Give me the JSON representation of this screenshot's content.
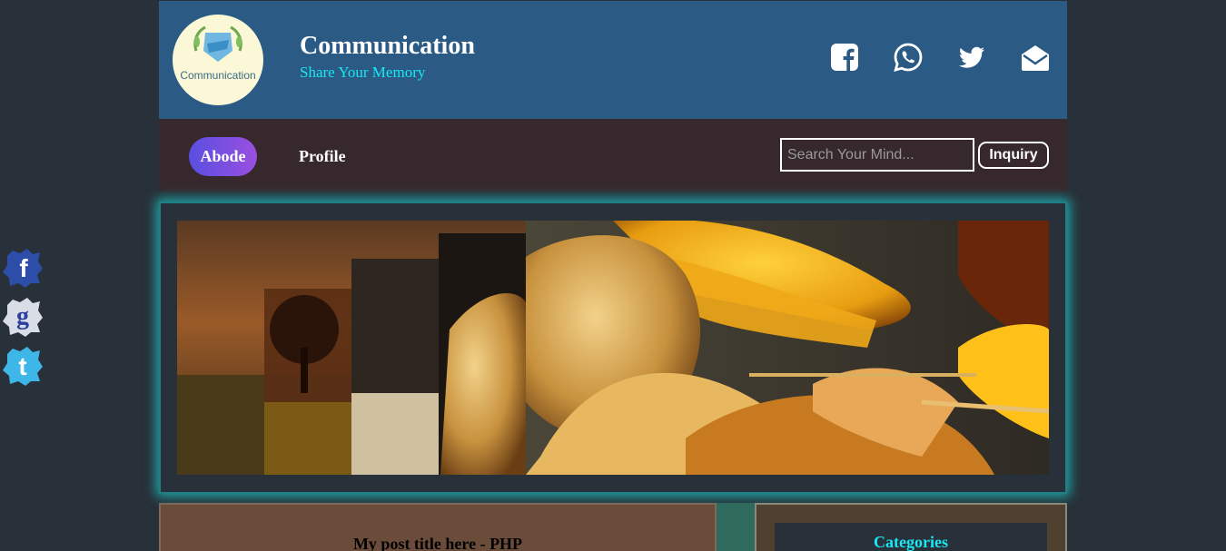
{
  "side_social": {
    "icons": [
      "facebook-icon",
      "google-icon",
      "twitter-icon"
    ],
    "color": "#2c4a9e"
  },
  "header": {
    "logo_text": "Communication",
    "title": "Communication",
    "tagline": "Share Your Memory",
    "icons": [
      "facebook-icon",
      "whatsapp-icon",
      "twitter-icon",
      "envelope-icon"
    ],
    "bg_color": "#2b5a85",
    "tagline_color": "#19e8f3"
  },
  "nav": {
    "home_label": "Abode",
    "profile_label": "Profile",
    "search_placeholder": "Search Your Mind...",
    "inquiry_label": "Inquiry",
    "bg_color": "#36282d"
  },
  "slider": {
    "glow_color": "#1ea7a9",
    "image": "autumn-leaves-slideshow"
  },
  "post": {
    "title": "My post title here - PHP"
  },
  "sidebar": {
    "categories_title": "Categories"
  }
}
